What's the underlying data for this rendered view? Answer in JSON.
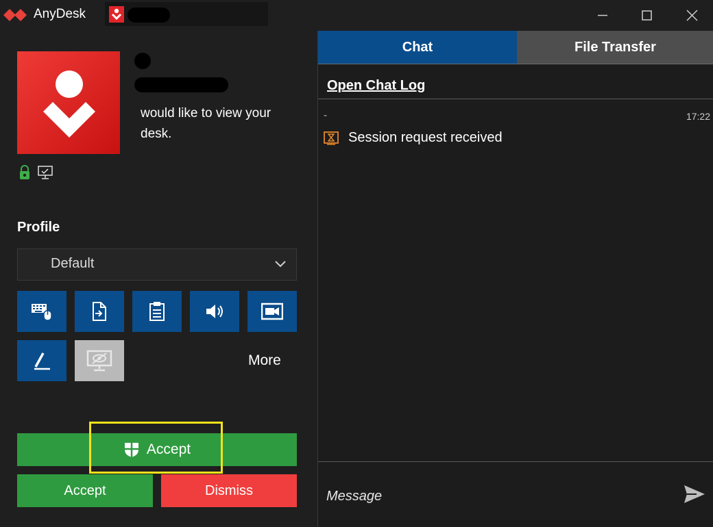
{
  "window": {
    "title": "AnyDesk",
    "controls": [
      "minimize-icon",
      "maximize-icon",
      "close-icon"
    ]
  },
  "request": {
    "message": "would like to view your desk.",
    "status_icons": [
      "lock-icon",
      "monitor-icon"
    ]
  },
  "profile": {
    "label": "Profile",
    "selected": "Default"
  },
  "permissions": [
    {
      "name": "keyboard-mouse-icon",
      "enabled": true
    },
    {
      "name": "file-transfer-icon",
      "enabled": true
    },
    {
      "name": "clipboard-icon",
      "enabled": true
    },
    {
      "name": "audio-icon",
      "enabled": true
    },
    {
      "name": "record-icon",
      "enabled": true
    },
    {
      "name": "draw-icon",
      "enabled": true
    },
    {
      "name": "privacy-mode-icon",
      "enabled": false
    }
  ],
  "more_label": "More",
  "actions": {
    "accept_main": "Accept",
    "accept": "Accept",
    "dismiss": "Dismiss"
  },
  "tabs": {
    "chat": "Chat",
    "file_transfer": "File Transfer"
  },
  "chat": {
    "open_log": "Open Chat Log",
    "messages": [
      {
        "sender": "-",
        "time": "17:22",
        "text": "Session request received"
      }
    ],
    "message_placeholder": "Message"
  },
  "colors": {
    "accent_blue": "#0a4d8c",
    "accept_green": "#2f9b40",
    "dismiss_red": "#f03e3e",
    "brand_red": "#e0252a",
    "highlight_yellow": "#f6e219"
  }
}
